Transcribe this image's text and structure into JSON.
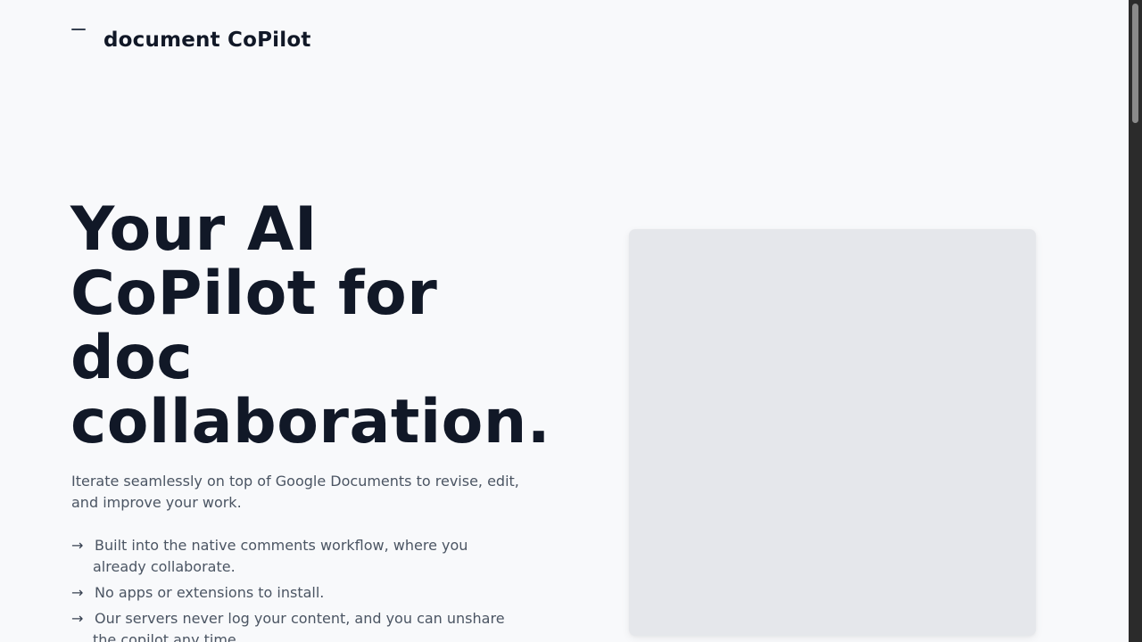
{
  "brand": {
    "name": "document CoPilot"
  },
  "hero": {
    "title": "Your AI CoPilot for doc collaboration.",
    "subtitle": "Iterate seamlessly on top of Google Documents to revise, edit, and improve your work.",
    "arrow_glyph": "→",
    "features": [
      {
        "text": "Built into the native comments workflow, where you already collaborate."
      },
      {
        "text": "No apps or extensions to install."
      },
      {
        "text": "Our servers never log your content, and you can unshare the copilot any time."
      }
    ]
  },
  "colors": {
    "background": "#f8f9fb",
    "heading": "#111827",
    "body_text": "#4b5563",
    "preview_placeholder": "#e5e7eb",
    "scrollbar_track": "#2b2b2b",
    "scrollbar_thumb": "#8a8a8a"
  },
  "icons": {
    "logo": "logo-mark-icon",
    "feature_bullet": "arrow-right-icon"
  }
}
